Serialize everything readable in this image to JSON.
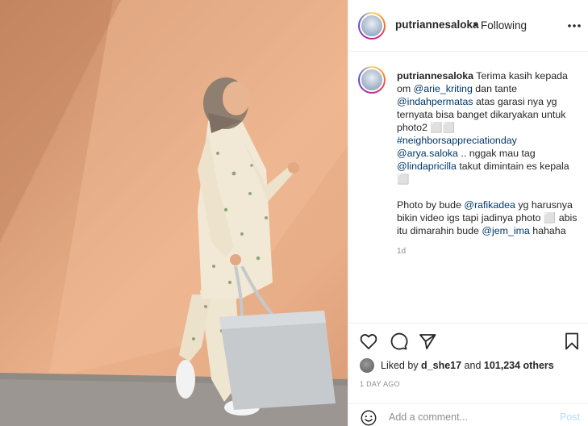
{
  "post": {
    "username": "putriannesaloka",
    "separator": "•",
    "follow_status": "Following"
  },
  "caption": {
    "username": "putriannesaloka",
    "line1": " Terima kasih kepada om ",
    "mention1": "@arie_kriting",
    "line2": " dan tante ",
    "mention2": "@indahpermatas",
    "line3": " atas garasi nya yg ternyata bisa banget dikaryakan untuk photo2 ⬜⬜",
    "hashtag": "#neighborsappreciationday",
    "mention3": "@arya.saloka",
    "line4": " .. nggak mau tag ",
    "mention4": "@lindapricilla",
    "line5": " takut dimintain es kepala ⬜",
    "line6": "Photo by bude ",
    "mention5": "@rafikadea",
    "line7": " yg harusnya bikin video igs tapi jadinya photo ⬜ abis itu dimarahin bude ",
    "mention6": "@jem_ima",
    "line8": " hahaha",
    "time": "1d"
  },
  "likes": {
    "prefix": "Liked by ",
    "user": "d_she17",
    "and": " and ",
    "count": "101,234 others"
  },
  "posted_ago": "1 DAY AGO",
  "comment": {
    "placeholder": "Add a comment...",
    "post_label": "Post"
  },
  "icons": {
    "more": "more-options-icon",
    "like": "heart-icon",
    "comment": "comment-bubble-icon",
    "share": "paper-plane-icon",
    "save": "bookmark-icon",
    "emoji": "smile-icon"
  },
  "colors": {
    "mention": "#00376b",
    "post_button": "#b2dffc",
    "muted": "#8e8e8e"
  }
}
